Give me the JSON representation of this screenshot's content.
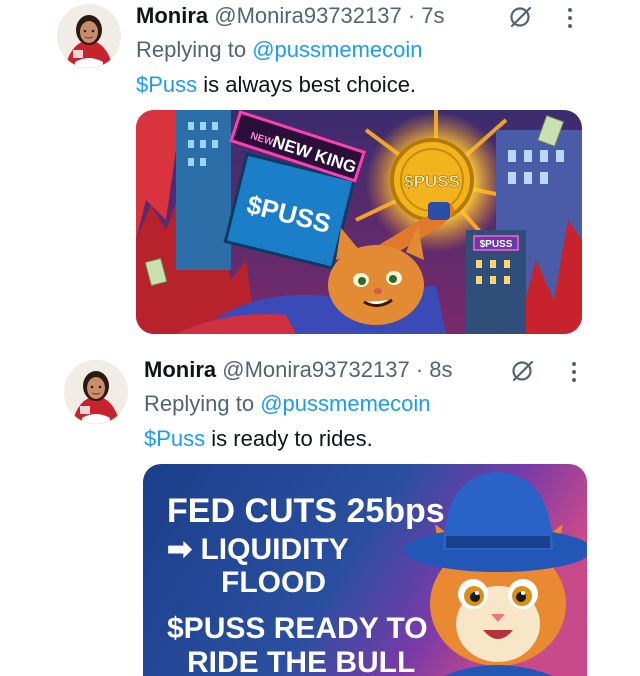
{
  "tweets": [
    {
      "name": "Monira",
      "handle": "@Monira93732137",
      "separator": "·",
      "time": "7s",
      "replying_label": "Replying to",
      "replying_to": "@pussmemecoin",
      "cashtag": "$Puss",
      "text": "is always best choice.",
      "media": {
        "banner_text": "NEW KING",
        "banner_tag": "NEW",
        "billboard_text": "$PUSS",
        "coin_text": "$PUSS",
        "sign_text": "$PUSS"
      }
    },
    {
      "name": "Monira",
      "handle": "@Monira93732137",
      "separator": "·",
      "time": "8s",
      "replying_label": "Replying to",
      "replying_to": "@pussmemecoin",
      "cashtag": "$Puss",
      "text": "is ready to rides.",
      "media": {
        "line1": "FED CUTS 25bps",
        "line2": "➡ LIQUIDITY",
        "line3": "FLOOD",
        "line4": "$PUSS READY TO",
        "line5": "RIDE THE BULL"
      }
    }
  ],
  "colors": {
    "accent": "#1d9bf0",
    "secondary_text": "#536471",
    "primary_text": "#0f1419"
  },
  "icons": {
    "grok": "grok-icon",
    "more": "more-dots-icon"
  }
}
